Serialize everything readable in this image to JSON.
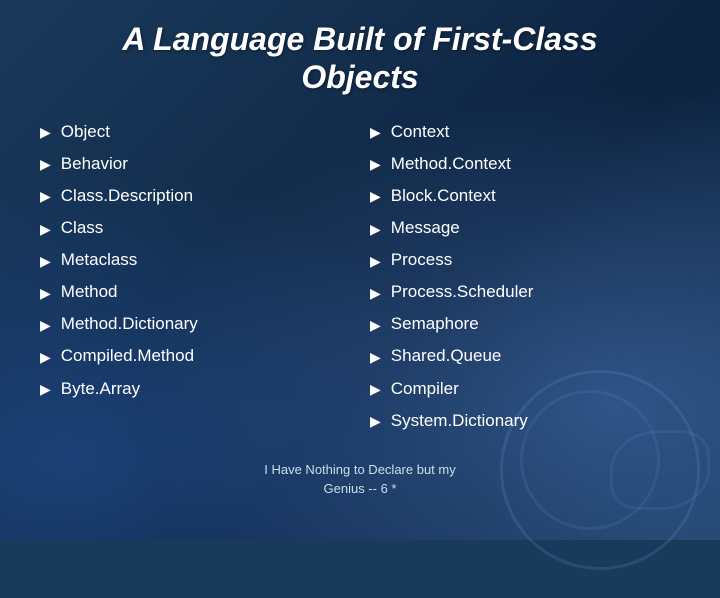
{
  "title": {
    "line1": "A Language Built of First-Class",
    "line2": "Objects"
  },
  "left_column": {
    "items": [
      "Object",
      "Behavior",
      "Class.Description",
      "Class",
      "Metaclass",
      "Method",
      "Method.Dictionary",
      "Compiled.Method",
      "Byte.Array"
    ]
  },
  "right_column": {
    "items": [
      "Context",
      "Method.Context",
      "Block.Context",
      "Message",
      "Process",
      "Process.Scheduler",
      "Semaphore",
      "Shared.Queue",
      "Compiler",
      "System.Dictionary"
    ]
  },
  "footer": {
    "line1": "I Have Nothing to Declare but my",
    "line2": "Genius -- 6 *"
  },
  "arrow_symbol": "▶"
}
